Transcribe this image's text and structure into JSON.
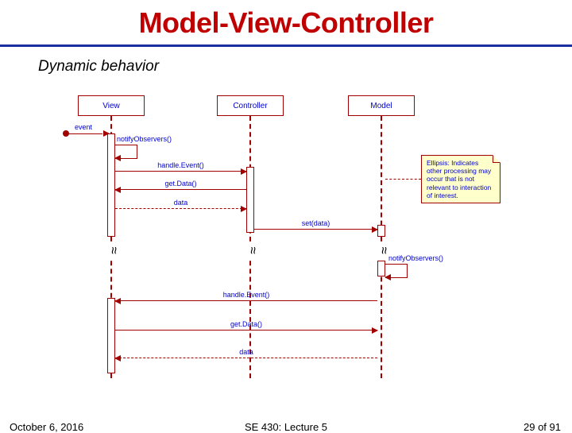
{
  "title": "Model-View-Controller",
  "subtitle": "Dynamic behavior",
  "lifelines": {
    "view": "View",
    "controller": "Controller",
    "model": "Model"
  },
  "messages": {
    "event": "event",
    "notifyObservers": "notifyObservers()",
    "handleEvent": "handle.Event()",
    "getData": "get.Data()",
    "data": "data",
    "setData": "set(data)"
  },
  "note": "Ellipsis: Indicates other processing may occur that is not relevant to interaction of interest.",
  "footer": {
    "date": "October 6, 2016",
    "course": "SE 430: Lecture 5",
    "page": "29 of 91"
  }
}
